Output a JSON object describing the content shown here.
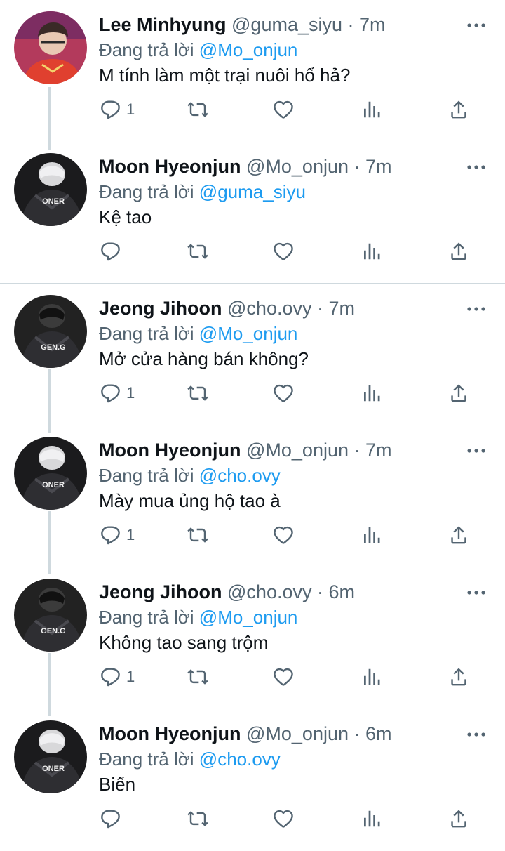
{
  "reply_prefix": "Đang trả lời",
  "colors": {
    "link": "#1d9bf0",
    "meta": "#536471",
    "thread_line": "#cfd9de"
  },
  "tweets": [
    {
      "name": "Lee Minhyung",
      "handle": "@guma_siyu",
      "time": "7m",
      "replying_to": "@Mo_onjun",
      "text": "M tính làm một trại nuôi hổ hả?",
      "reply_count": "1",
      "avatar_icon": "avatar-red-jersey"
    },
    {
      "name": "Moon Hyeonjun",
      "handle": "@Mo_onjun",
      "time": "7m",
      "replying_to": "@guma_siyu",
      "text": "Kệ tao",
      "reply_count": "",
      "avatar_icon": "avatar-oner-jersey"
    },
    {
      "name": "Jeong Jihoon",
      "handle": "@cho.ovy",
      "time": "7m",
      "replying_to": "@Mo_onjun",
      "text": "Mở cửa hàng bán không?",
      "reply_count": "1",
      "avatar_icon": "avatar-geng-jersey"
    },
    {
      "name": "Moon Hyeonjun",
      "handle": "@Mo_onjun",
      "time": "7m",
      "replying_to": "@cho.ovy",
      "text": "Mày mua ủng hộ tao à",
      "reply_count": "1",
      "avatar_icon": "avatar-oner-jersey"
    },
    {
      "name": "Jeong Jihoon",
      "handle": "@cho.ovy",
      "time": "6m",
      "replying_to": "@Mo_onjun",
      "text": "Không tao sang trộm",
      "reply_count": "1",
      "avatar_icon": "avatar-geng-jersey"
    },
    {
      "name": "Moon Hyeonjun",
      "handle": "@Mo_onjun",
      "time": "6m",
      "replying_to": "@cho.ovy",
      "text": "Biến",
      "reply_count": "",
      "avatar_icon": "avatar-oner-jersey"
    }
  ],
  "avatar_text": {
    "oner": "ONER",
    "geng": "GEN.G"
  }
}
